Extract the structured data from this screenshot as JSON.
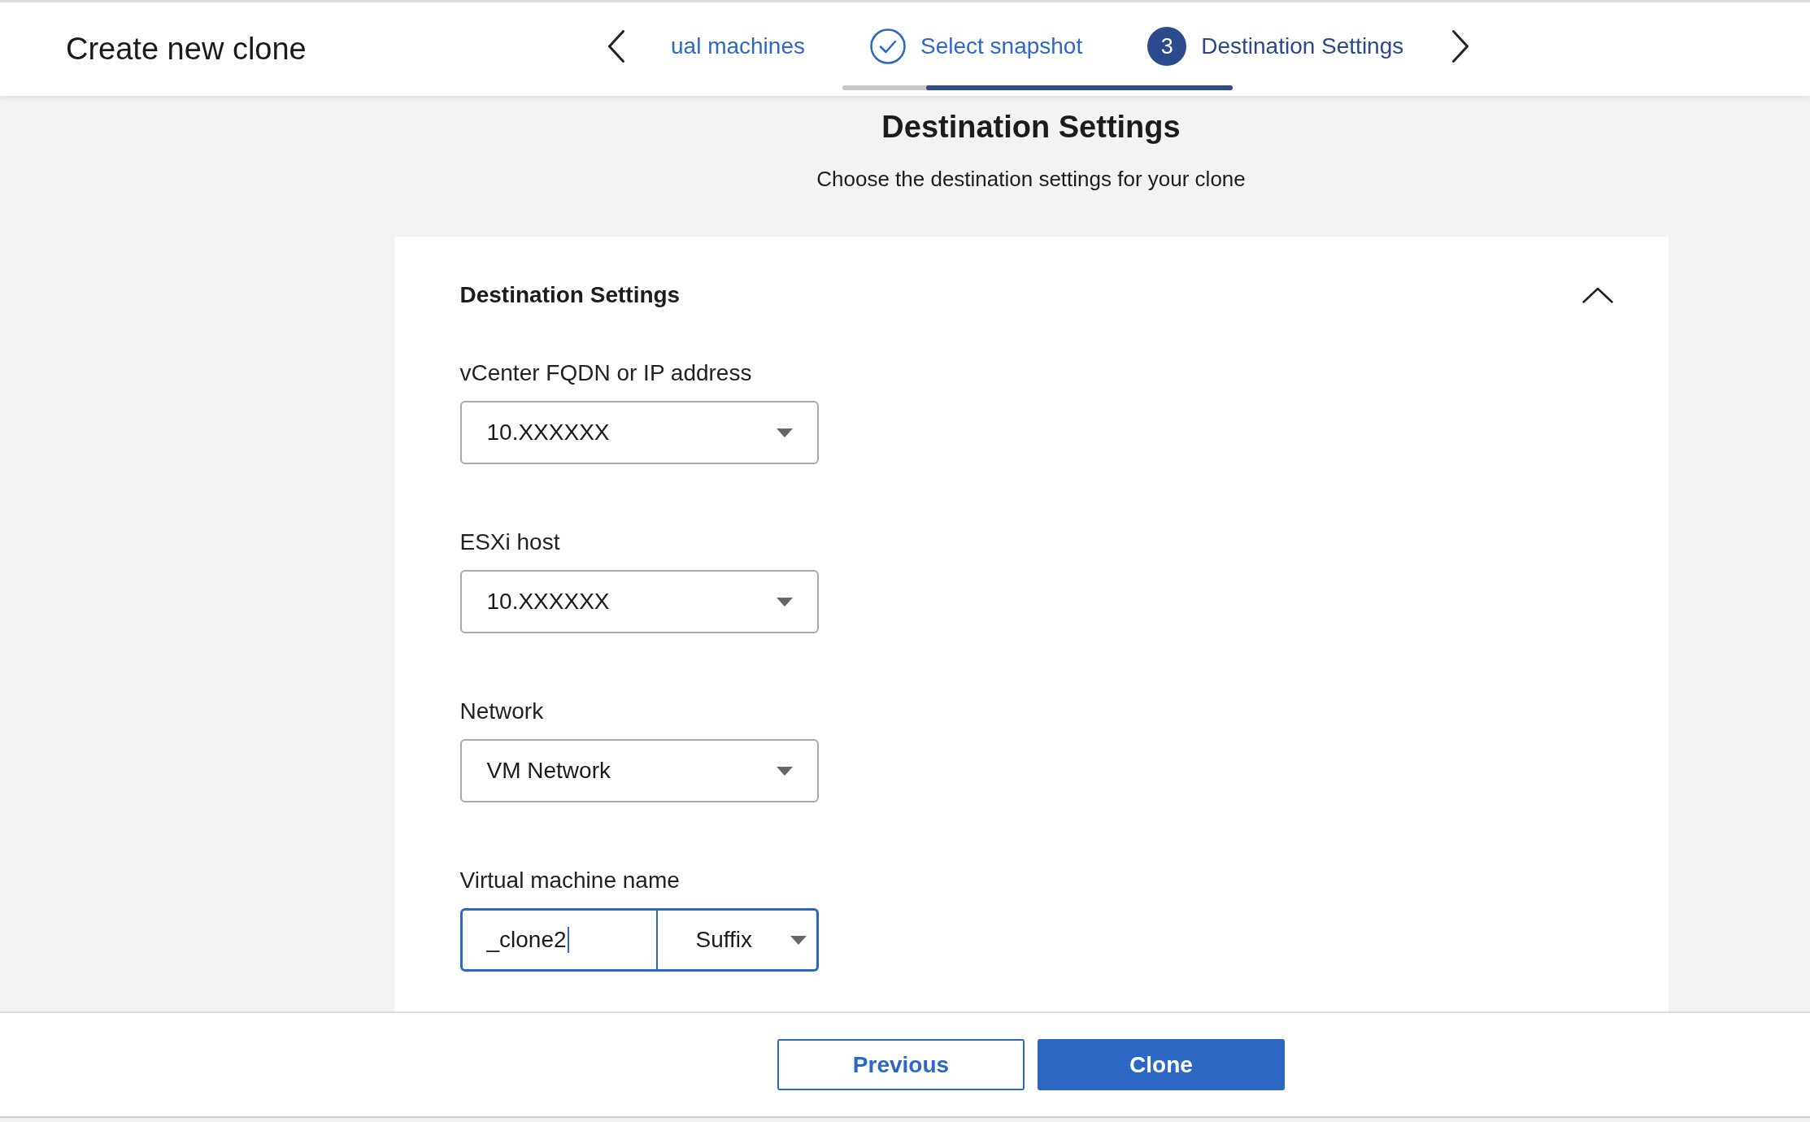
{
  "header": {
    "title": "Create new clone"
  },
  "stepper": {
    "steps": [
      {
        "kind": "plain",
        "label": "ual machines",
        "selected": false
      },
      {
        "kind": "check",
        "label": "Select snapshot",
        "selected": false
      },
      {
        "kind": "number",
        "label": "Destination Settings",
        "selected": true,
        "number": "3"
      }
    ]
  },
  "page": {
    "title": "Destination Settings",
    "subtitle": "Choose the destination settings for your clone"
  },
  "section": {
    "title": "Destination Settings",
    "expanded": true,
    "fields": [
      {
        "kind": "select",
        "label": "vCenter FQDN or IP address",
        "value": "10.XXXXXX",
        "focused": false
      },
      {
        "kind": "select",
        "label": "ESXi host",
        "value": "10.XXXXXX",
        "focused": false
      },
      {
        "kind": "select",
        "label": "Network",
        "value": "VM Network",
        "focused": false
      },
      {
        "kind": "text_with_select",
        "label": "Virtual machine name",
        "value": "_clone2",
        "option": "Suffix",
        "focused": true
      }
    ]
  },
  "footer": {
    "buttons": [
      {
        "label": "Previous",
        "kind": "secondary"
      },
      {
        "label": "Clone",
        "kind": "primary"
      }
    ]
  }
}
